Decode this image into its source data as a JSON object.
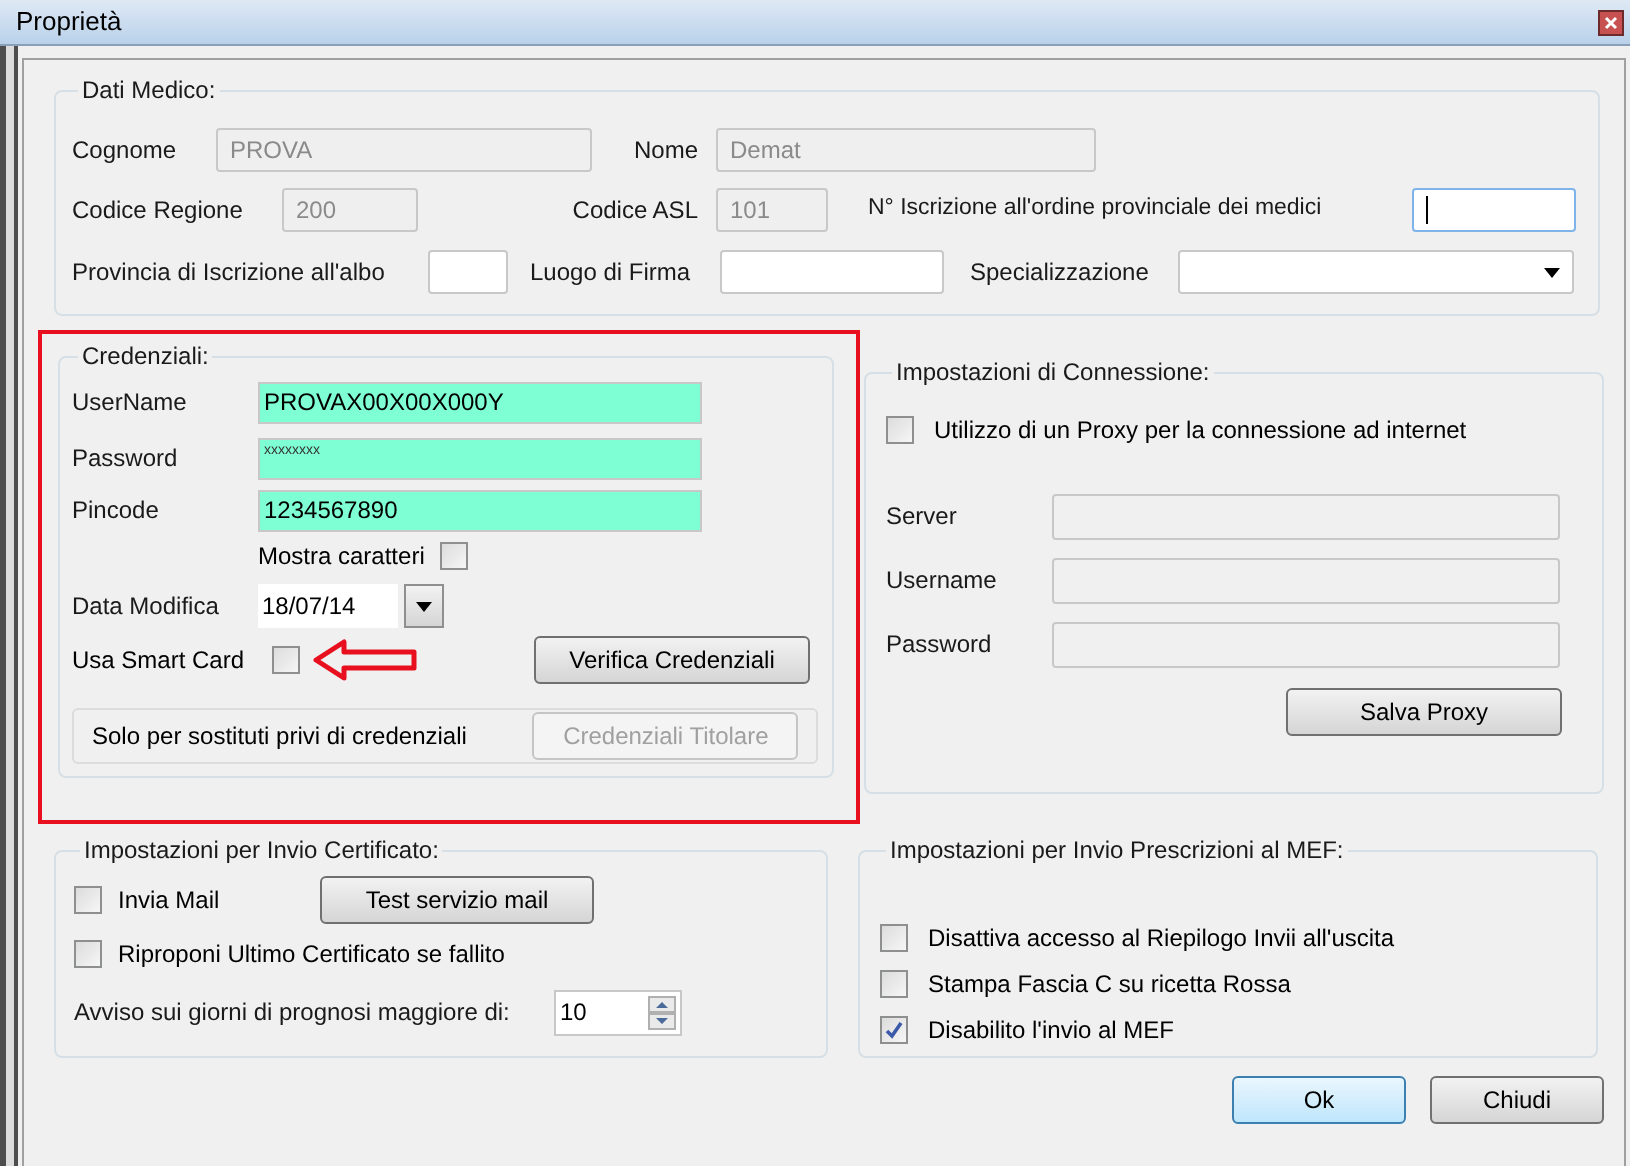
{
  "window": {
    "title": "Proprietà"
  },
  "dati_medico": {
    "title": "Dati Medico:",
    "cognome": {
      "label": "Cognome",
      "value": "PROVA",
      "disabled": true
    },
    "nome": {
      "label": "Nome",
      "value": "Demat",
      "disabled": true
    },
    "codice_regione": {
      "label": "Codice Regione",
      "value": "200",
      "disabled": true
    },
    "codice_asl": {
      "label": "Codice ASL",
      "value": "101",
      "disabled": true
    },
    "iscrizione": {
      "label": "N° Iscrizione all'ordine provinciale dei medici",
      "focused": true
    },
    "provincia": {
      "label": "Provincia di Iscrizione all'albo"
    },
    "luogo": {
      "label": "Luogo di Firma"
    },
    "specializzazione": {
      "label": "Specializzazione"
    }
  },
  "credenziali": {
    "title": "Credenziali:",
    "username": {
      "label": "UserName",
      "value": "PROVAX00X00X000Y"
    },
    "password": {
      "label": "Password",
      "value": "xxxxxxxx"
    },
    "pincode": {
      "label": "Pincode",
      "value": "1234567890"
    },
    "mostra": {
      "label": "Mostra caratteri",
      "checked": false
    },
    "data_modifica": {
      "label": "Data Modifica",
      "value": "18/07/14"
    },
    "smart_card": {
      "label": "Usa Smart Card",
      "checked": false
    },
    "verifica_button": "Verifica Credenziali",
    "sostituti": {
      "label": "Solo per sostituti privi di credenziali",
      "button": {
        "label": "Credenziali Titolare",
        "disabled": true
      }
    }
  },
  "connessione": {
    "title": "Impostazioni di Connessione:",
    "proxy": {
      "label": "Utilizzo di un Proxy per la connessione ad internet",
      "checked": false
    },
    "fields": [
      {
        "label": "Server"
      },
      {
        "label": "Username"
      },
      {
        "label": "Password"
      }
    ],
    "salva_button": "Salva Proxy"
  },
  "certificato": {
    "title": "Impostazioni per Invio Certificato:",
    "invia_mail": {
      "label": "Invia Mail",
      "checked": false
    },
    "test_button": "Test servizio mail",
    "riproponi": {
      "label": "Riproponi Ultimo Certificato se fallito",
      "checked": false
    },
    "avviso": {
      "label": "Avviso sui giorni di prognosi maggiore di:",
      "value": "10"
    }
  },
  "mef": {
    "title": "Impostazioni per Invio Prescrizioni al MEF:",
    "options": [
      {
        "label": "Disattiva accesso al Riepilogo Invii all'uscita",
        "checked": false
      },
      {
        "label": "Stampa Fascia C su ricetta Rossa",
        "checked": false
      },
      {
        "label": "Disabilito l'invio al MEF",
        "checked": true
      }
    ]
  },
  "buttons": [
    {
      "label": "Ok",
      "default": true
    },
    {
      "label": "Chiudi",
      "default": false
    }
  ]
}
